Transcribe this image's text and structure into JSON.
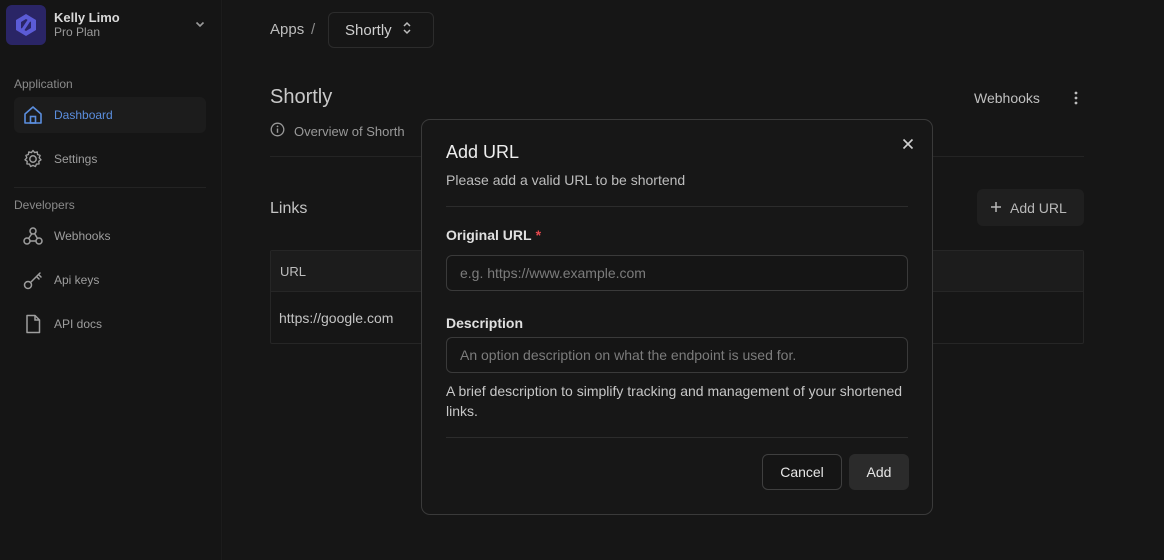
{
  "account": {
    "name": "Kelly Limo",
    "plan": "Pro Plan"
  },
  "sidebar": {
    "sections": [
      {
        "label": "Application",
        "items": [
          {
            "label": "Dashboard",
            "icon": "home-icon",
            "active": true
          },
          {
            "label": "Settings",
            "icon": "gear-icon"
          }
        ]
      },
      {
        "label": "Developers",
        "items": [
          {
            "label": "Webhooks",
            "icon": "webhook-icon"
          },
          {
            "label": "Api keys",
            "icon": "key-icon"
          },
          {
            "label": "API docs",
            "icon": "document-icon"
          }
        ]
      }
    ]
  },
  "breadcrumb": {
    "root": "Apps",
    "separator": "/",
    "current": "Shortly"
  },
  "page": {
    "title": "Shortly",
    "overview": "Overview of Shorth",
    "webhooks_link": "Webhooks",
    "links_title": "Links",
    "add_url_button": "Add URL",
    "table": {
      "columns": [
        "URL"
      ],
      "rows": [
        [
          "https://google.com"
        ]
      ]
    }
  },
  "modal": {
    "title": "Add URL",
    "subtitle": "Please add a valid URL to be shortend",
    "original_url": {
      "label": "Original URL",
      "required_mark": "*",
      "placeholder": "e.g. https://www.example.com",
      "value": ""
    },
    "description": {
      "label": "Description",
      "placeholder": "An option description on what the endpoint is used for.",
      "value": "",
      "help": "A brief description to simplify tracking and management of your shortened links."
    },
    "cancel_button": "Cancel",
    "add_button": "Add"
  },
  "colors": {
    "accent": "#5b8ede",
    "required": "#e5484d",
    "logo_bg": "#2a2566"
  }
}
